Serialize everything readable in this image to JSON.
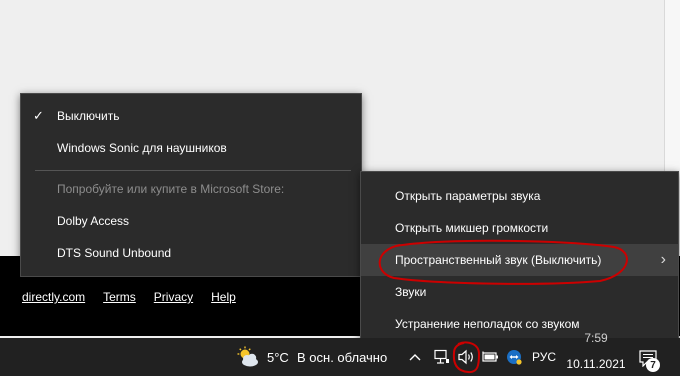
{
  "footer_links": [
    "directly.com",
    "Terms",
    "Privacy",
    "Help"
  ],
  "spatial_menu": {
    "items": [
      {
        "label": "Выключить",
        "checked": true
      },
      {
        "label": "Windows Sonic для наушников"
      }
    ],
    "store_hint": "Попробуйте или купите в Microsoft Store:",
    "store_items": [
      "Dolby Access",
      "DTS Sound Unbound"
    ]
  },
  "sound_menu": {
    "items": [
      "Открыть параметры звука",
      "Открыть микшер громкости",
      "Пространственный звук (Выключить)",
      "Звуки",
      "Устранение неполадок со звуком"
    ],
    "highlighted_index": 2
  },
  "taskbar": {
    "weather_temp": "5°C",
    "weather_desc": "В осн. облачно",
    "language": "РУС",
    "time": "7:59",
    "date": "10.11.2021",
    "notification_count": "7"
  },
  "icons": [
    "checkmark-icon",
    "chevron-right-icon",
    "weather-icon",
    "chevron-up-icon",
    "network-icon",
    "speaker-icon",
    "battery-icon",
    "teamviewer-icon",
    "notification-icon"
  ],
  "colors": {
    "menu_bg": "#2b2b2b",
    "menu_highlight": "#404040",
    "annotation": "#cc0000",
    "taskbar": "#212121"
  }
}
